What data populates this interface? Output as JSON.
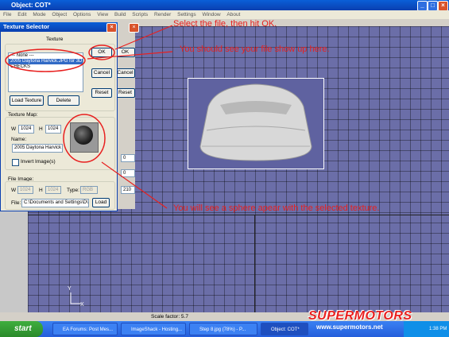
{
  "main_window": {
    "title": "Object: COT*",
    "menu": [
      "File",
      "Edit",
      "Mode",
      "Object",
      "Options",
      "View",
      "Build",
      "Scripts",
      "Render",
      "Settings",
      "Window",
      "About"
    ],
    "status": "Scale factor: 5.7",
    "axis_y": "Y",
    "axis_x": "X"
  },
  "dialog": {
    "title": "Texture Selector",
    "section_texture": "Texture",
    "list_items": [
      "--- None ---",
      "2005 Daytona Harvick.JPG for 3D",
      "CHECKS"
    ],
    "ok": "OK",
    "cancel": "Cancel",
    "reset": "Reset",
    "load_texture": "Load Texture",
    "delete": "Delete",
    "texture_map": "Texture Map:",
    "w_label": "W",
    "h_label": "H",
    "w_value": "1024",
    "h_value": "1024",
    "name_label": "Name:",
    "name_value": "2005 Daytona Harvick",
    "invert": "Invert Image(s)",
    "file_image": "File Image:",
    "file_w": "1024",
    "file_h": "1024",
    "type_label": "Type:",
    "type_value": "RGB",
    "file_label": "File:",
    "file_value": "C:\\Documents and Settings\\D\\",
    "load": "Load"
  },
  "side_panel": {
    "ok": "OK",
    "cancel": "Cancel",
    "reset": "Reset",
    "field1": "0",
    "field2": "0",
    "field3": "210"
  },
  "annotations": {
    "a1": "Select the file, then hit OK.",
    "a2": "You should see your file show up here.",
    "a3": "You will see a sphere apear with the selected texture."
  },
  "taskbar": {
    "start": "start",
    "tasks": [
      "EA Forums: Post Mes...",
      "ImageShack - Hosting...",
      "Step 8.jpg (78%) - P...",
      "Object: COT*"
    ],
    "clock": "1:38 PM"
  },
  "watermark": {
    "logo": "SUPERMOTORS",
    "url": "www.supermotors.net"
  },
  "colors": {
    "annotation": "#e8201f",
    "viewport": "#6b6ea8",
    "titlebar": "#0a5fd8"
  }
}
